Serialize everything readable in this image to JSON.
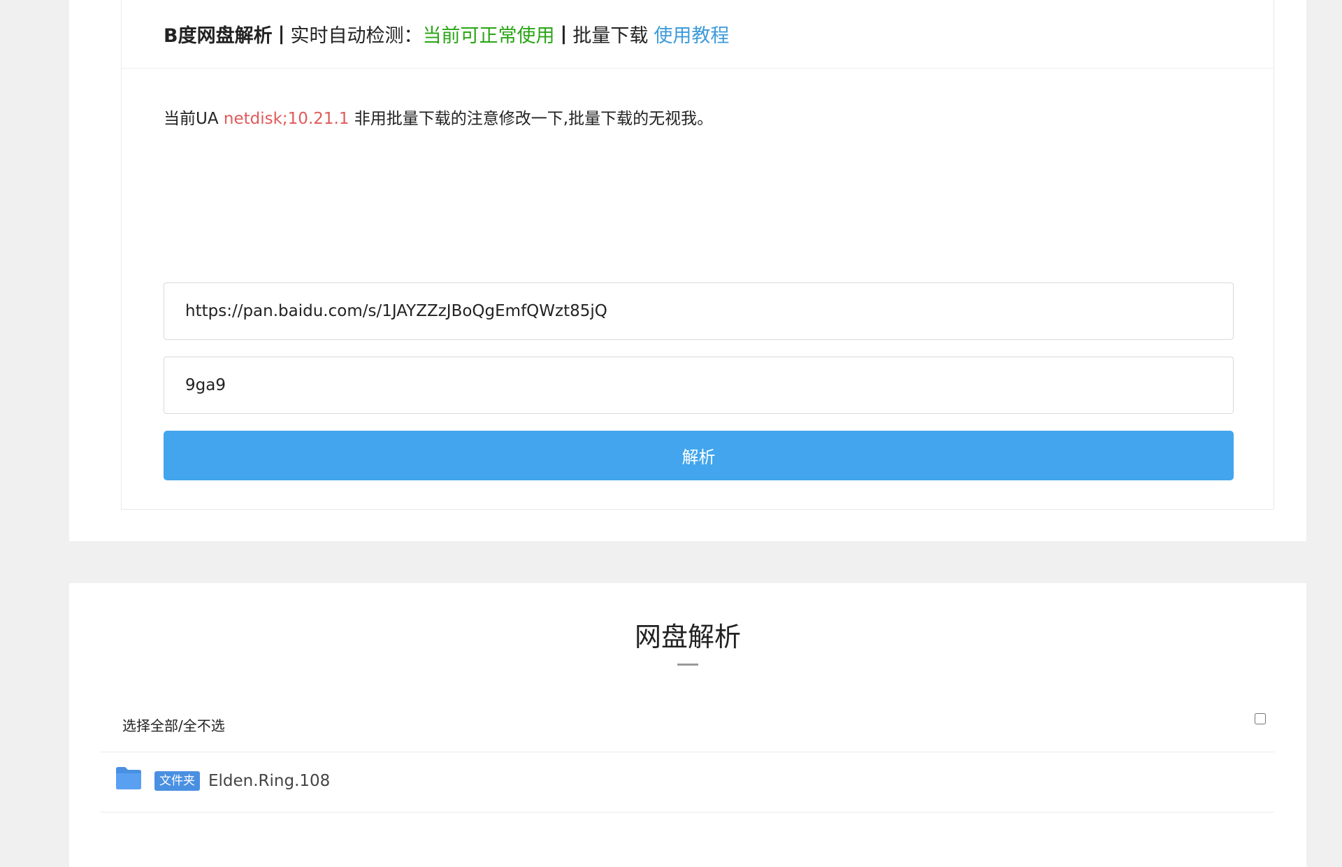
{
  "header": {
    "brand": "B度网盘解析",
    "sep1": "|",
    "detect_label": "实时自动检测：",
    "status": "当前可正常使用",
    "sep2": "|",
    "batch_label": "批量下载",
    "tutorial_link": "使用教程"
  },
  "notice": {
    "prefix": "当前UA",
    "ua": "netdisk;10.21.1",
    "suffix": "非用批量下载的注意修改一下,批量下载的无视我。"
  },
  "form": {
    "url_value": "https://pan.baidu.com/s/1JAYZZzJBoQgEmfQWzt85jQ",
    "password_value": "9ga9",
    "submit_label": "解析"
  },
  "results": {
    "title": "网盘解析",
    "select_all_label": "选择全部/全不选",
    "select_all_checked": false,
    "items": [
      {
        "icon": "folder-icon",
        "tag": "文件夹",
        "name": "Elden.Ring.108"
      }
    ]
  },
  "colors": {
    "status_ok": "#2aa515",
    "link": "#3d9bdb",
    "ua_highlight": "#e05a5a",
    "button": "#42a5ed",
    "tag": "#4a90e2",
    "folder": "#4a90e2"
  }
}
